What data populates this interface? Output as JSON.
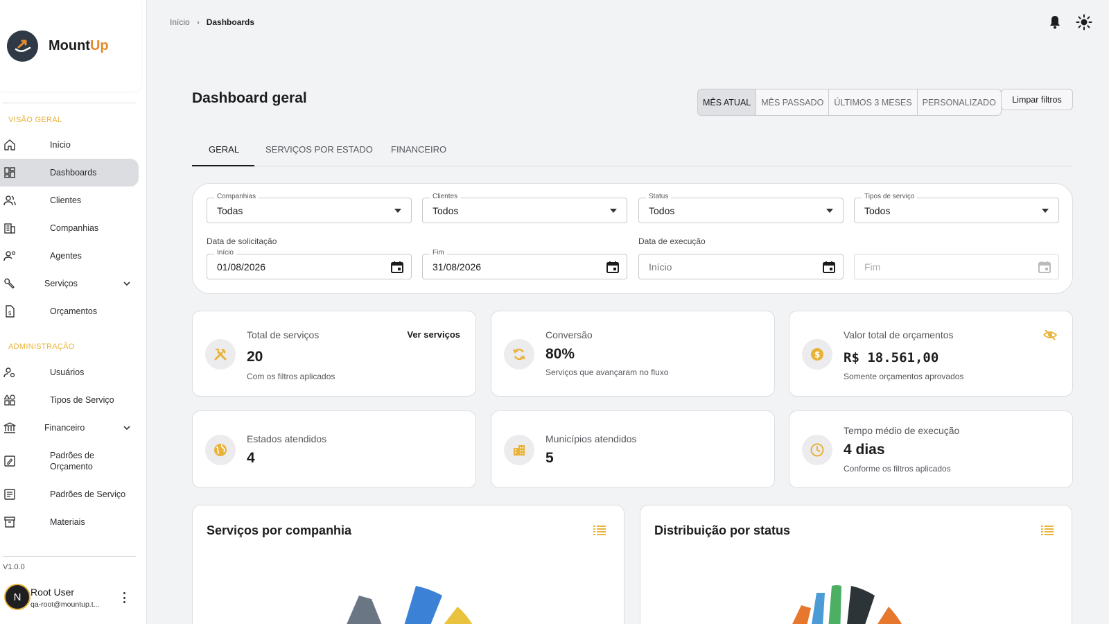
{
  "brand": {
    "name_part1": "Mount",
    "name_part2": "Up"
  },
  "sidebar": {
    "section_overview": "VISÃO GERAL",
    "section_admin": "ADMINISTRAÇÃO",
    "items": [
      {
        "label": "Início"
      },
      {
        "label": "Dashboards"
      },
      {
        "label": "Clientes"
      },
      {
        "label": "Companhias"
      },
      {
        "label": "Agentes"
      },
      {
        "label": "Serviços"
      },
      {
        "label": "Orçamentos"
      },
      {
        "label": "Usuários"
      },
      {
        "label": "Tipos de Serviço"
      },
      {
        "label": "Financeiro"
      },
      {
        "label": "Padrões de Orçamento"
      },
      {
        "label": "Padrões de Serviço"
      },
      {
        "label": "Materiais"
      }
    ],
    "version": "V1.0.0",
    "user": {
      "initial": "N",
      "name": "Root User",
      "email": "qa-root@mountup.t..."
    }
  },
  "header": {
    "breadcrumb": {
      "home": "Início",
      "separator": "›",
      "current": "Dashboards"
    }
  },
  "main": {
    "title": "Dashboard geral",
    "period_options": [
      "MÊS ATUAL",
      "MÊS PASSADO",
      "ÚLTIMOS 3 MESES",
      "PERSONALIZADO"
    ],
    "selected_period": "MÊS ATUAL",
    "clear_filters": "Limpar filtros",
    "tabs": [
      "GERAL",
      "SERVIÇOS POR ESTADO",
      "FINANCEIRO"
    ],
    "active_tab": "GERAL"
  },
  "filters": {
    "companhias": {
      "label": "Companhias",
      "value": "Todas"
    },
    "clientes": {
      "label": "Clientes",
      "value": "Todos"
    },
    "status": {
      "label": "Status",
      "value": "Todos"
    },
    "tipos": {
      "label": "Tipos de serviço",
      "value": "Todos"
    },
    "solicitacao": {
      "group": "Data de solicitação",
      "start_label": "Início",
      "start": "01/08/2026",
      "end_label": "Fim",
      "end": "31/08/2026"
    },
    "execucao": {
      "group": "Data de execução",
      "start_placeholder": "Início",
      "end_placeholder": "Fim"
    }
  },
  "cards": {
    "total": {
      "title": "Total de serviços",
      "value": "20",
      "sub": "Com os filtros aplicados",
      "link": "Ver serviços"
    },
    "conversao": {
      "title": "Conversão",
      "value": "80%",
      "sub": "Serviços que avançaram no fluxo"
    },
    "orcamentos": {
      "title": "Valor total de orçamentos",
      "value": "R$ 18.561,00",
      "sub": "Somente orçamentos aprovados"
    },
    "estados": {
      "title": "Estados atendidos",
      "value": "4"
    },
    "municipios": {
      "title": "Municípios atendidos",
      "value": "5"
    },
    "tempo": {
      "title": "Tempo médio de execução",
      "value": "4 dias",
      "sub": "Conforme os filtros aplicados"
    }
  },
  "panels": {
    "companhia": {
      "title": "Serviços por companhia"
    },
    "status": {
      "title": "Distribuição por status"
    }
  },
  "colors": {
    "accent": "#e9b33a",
    "brand_orange": "#e68a2e",
    "chart_company": [
      "#6b7685",
      "#3b82d6",
      "#e9c23e"
    ],
    "chart_status": [
      "#e8772e",
      "#4a9bd6",
      "#4caf64",
      "#2d3438",
      "#e8772e"
    ]
  }
}
